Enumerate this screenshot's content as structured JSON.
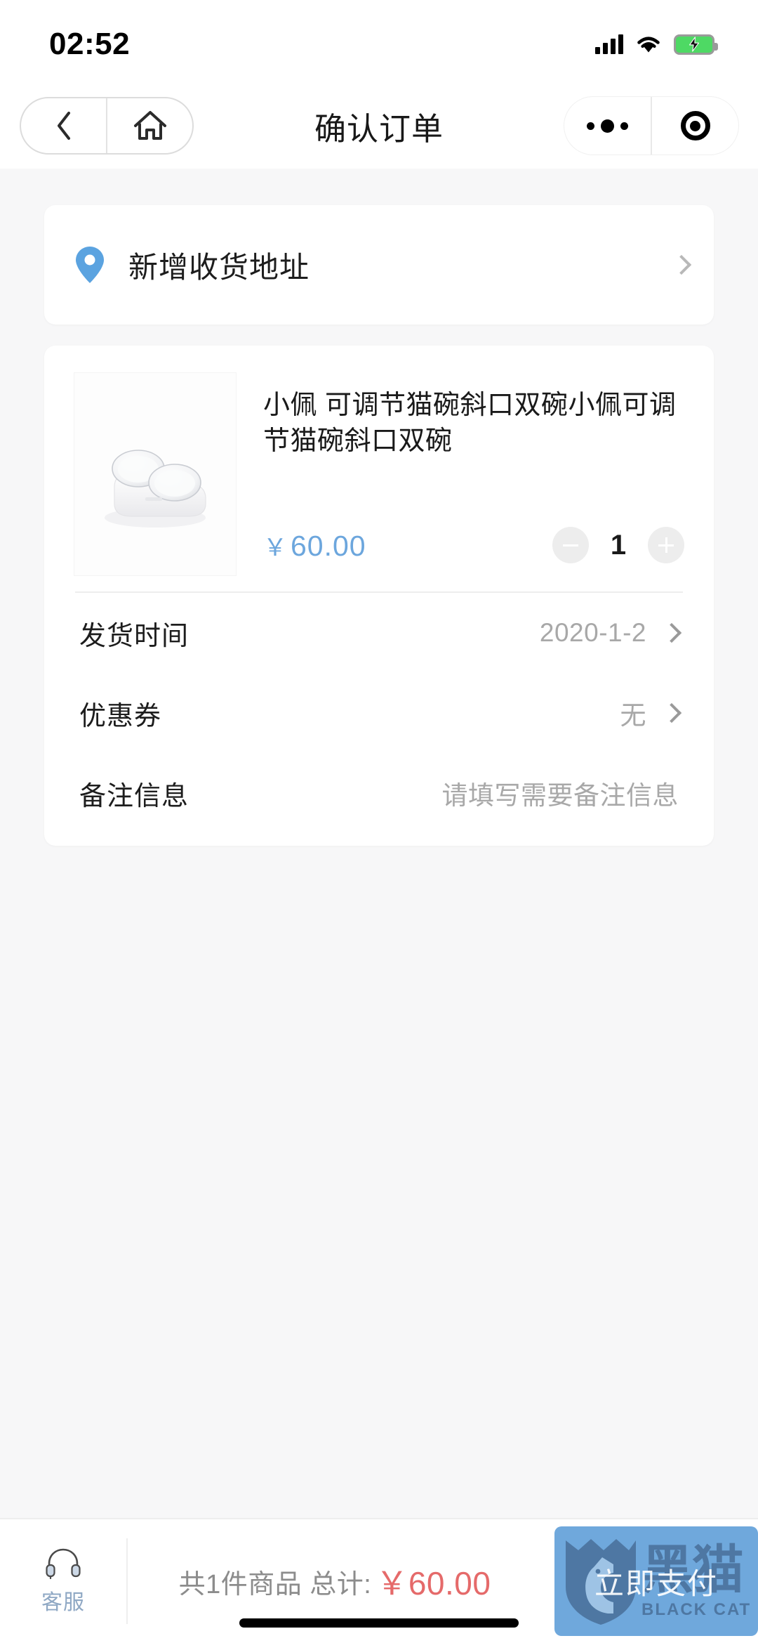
{
  "status_bar": {
    "time": "02:52",
    "signal_icon": "signal-bars-icon",
    "wifi_icon": "wifi-icon",
    "battery_icon": "battery-charging-icon"
  },
  "nav": {
    "title": "确认订单",
    "back_icon": "chevron-left-icon",
    "home_icon": "home-icon",
    "more_icon": "more-dots-icon",
    "close_icon": "target-circle-icon"
  },
  "address": {
    "label": "新增收货地址",
    "pin_icon": "location-pin-icon",
    "pin_color": "#5ba3e0",
    "chevron_icon": "chevron-right-icon"
  },
  "product": {
    "image_icon": "cat-bowl-product-image",
    "title": "小佩 可调节猫碗斜口双碗小佩可调节猫碗斜口双碗",
    "currency_symbol": "￥",
    "price": "60.00",
    "price_color": "#6ca6dd",
    "quantity": "1",
    "decrease_icon": "minus-icon",
    "increase_icon": "plus-icon"
  },
  "details": [
    {
      "label": "发货时间",
      "value": "2020-1-2",
      "has_chevron": true
    },
    {
      "label": "优惠券",
      "value": "无",
      "has_chevron": true
    },
    {
      "label": "备注信息",
      "value": "请填写需要备注信息",
      "has_chevron": false
    }
  ],
  "bottom_bar": {
    "service_label": "客服",
    "service_icon": "headset-icon",
    "total_text": "共1件商品 总计:",
    "total_currency": "￥",
    "total_price": "60.00",
    "total_price_color": "#e56a6a",
    "pay_label": "立即支付",
    "pay_button_color": "#6fa8dc"
  },
  "watermark": {
    "shield_icon": "black-cat-shield-icon",
    "cn_text": "黑猫",
    "en_text": "BLACK CAT",
    "color": "#3a5a80"
  }
}
